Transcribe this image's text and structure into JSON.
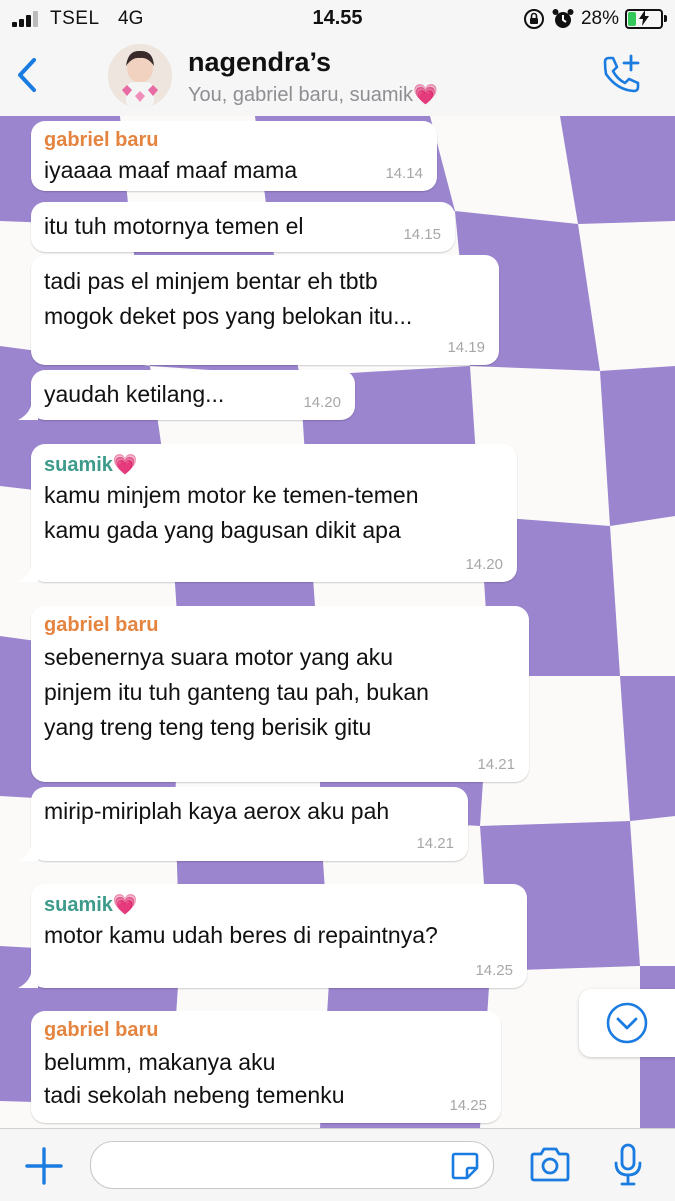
{
  "status": {
    "carrier": "TSEL",
    "network": "4G",
    "time": "14.55",
    "battery_pct": "28%",
    "battery_level": 0.28,
    "icons": [
      "signal-icon",
      "lock-rotation-icon",
      "alarm-icon",
      "battery-charging-icon"
    ]
  },
  "header": {
    "title": "nagendra’s",
    "subtitle": "You, gabriel baru, suamik💗",
    "back_icon": "chevron-left-icon",
    "call_icon": "add-call-icon"
  },
  "colors": {
    "accent": "#1a7ce0",
    "chat_purple": "#9b85cf",
    "gabriel": "#e4843f",
    "suamik": "#3d9b8c"
  },
  "messages": [
    {
      "sender": "gabriel baru",
      "lines": [
        "iyaaaa maaf maaf mama"
      ],
      "time": "14.14"
    },
    {
      "sender": "",
      "lines": [
        "itu tuh motornya temen el"
      ],
      "time": "14.15"
    },
    {
      "sender": "",
      "lines": [
        "tadi pas el minjem bentar eh tbtb",
        "mogok deket pos yang belokan itu..."
      ],
      "time": "14.19"
    },
    {
      "sender": "",
      "lines": [
        "yaudah ketilang..."
      ],
      "time": "14.20"
    },
    {
      "sender": "suamik💗",
      "lines": [
        "kamu minjem motor ke temen-temen",
        "kamu gada yang bagusan dikit apa"
      ],
      "time": "14.20"
    },
    {
      "sender": "gabriel baru",
      "lines": [
        "sebenernya suara motor yang aku",
        "pinjem itu tuh ganteng tau pah, bukan",
        "yang treng teng teng berisik gitu"
      ],
      "time": "14.21"
    },
    {
      "sender": "",
      "lines": [
        "mirip-miriplah kaya aerox aku pah"
      ],
      "time": "14.21"
    },
    {
      "sender": "suamik💗",
      "lines": [
        "motor kamu udah beres di repaintnya?"
      ],
      "time": "14.25"
    },
    {
      "sender": "gabriel baru",
      "lines": [
        "belumm, makanya aku",
        "tadi sekolah nebeng temenku"
      ],
      "time": "14.25"
    }
  ],
  "input": {
    "value": "",
    "placeholder": "",
    "icons": [
      "plus-icon",
      "sticker-icon",
      "camera-icon",
      "microphone-icon",
      "scroll-down-icon"
    ]
  }
}
